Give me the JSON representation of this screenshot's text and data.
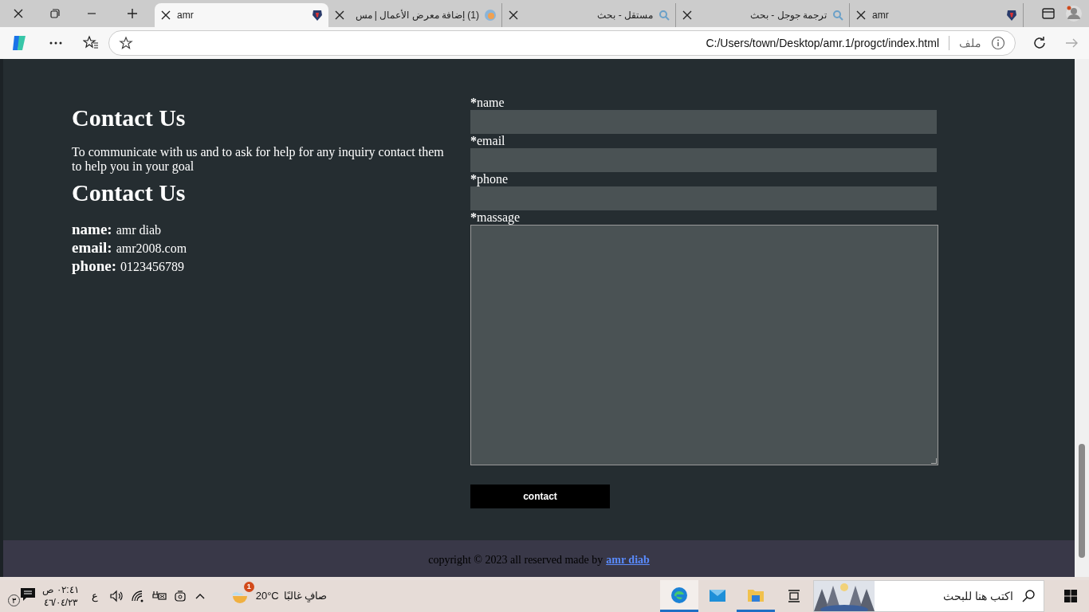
{
  "browser": {
    "tabs": [
      {
        "title": "amr",
        "selected": false,
        "kind": "shield"
      },
      {
        "title": "ترجمة جوجل - بحث",
        "selected": false,
        "kind": "search"
      },
      {
        "title": "مستقل - بحث",
        "selected": false,
        "kind": "search"
      },
      {
        "title": "(1) إضافة معرض الأعمال | مس",
        "selected": false,
        "kind": "globe"
      },
      {
        "title": "amr",
        "selected": true,
        "kind": "shield"
      }
    ],
    "address_bar": {
      "scheme": "ملف",
      "url": "C:/Users/town/Desktop/amr.1/progct/index.html"
    }
  },
  "page": {
    "intro_heading": "Contact Us",
    "intro": "To communicate with us and to ask for help for any inquiry contact them to help you in your goal",
    "details_heading": "Contact Us",
    "details": [
      {
        "label": "name:",
        "value": "amr diab"
      },
      {
        "label": "email:",
        "value": "amr2008.com"
      },
      {
        "label": "phone:",
        "value": "0123456789"
      }
    ],
    "form": {
      "fields": [
        {
          "mark": "*",
          "label": "name",
          "kind": "input"
        },
        {
          "mark": "*",
          "label": "email",
          "kind": "input"
        },
        {
          "mark": "*",
          "label": "phone",
          "kind": "input"
        },
        {
          "mark": "*",
          "label": "massage",
          "kind": "textarea"
        }
      ],
      "button": "contact"
    },
    "footer": {
      "text": "copyright © 2023 all reserved made by",
      "link": "amr diab"
    }
  },
  "taskbar": {
    "search_placeholder": "اكتب هنا للبحث",
    "apps": [
      {
        "kind": "edge",
        "running": true,
        "selected": true
      },
      {
        "kind": "mail",
        "running": false,
        "selected": false
      },
      {
        "kind": "explorer",
        "running": true,
        "selected": false
      }
    ],
    "weather": {
      "temperature": "20°C",
      "condition": "صافٍ غالبًا",
      "badge": "1"
    },
    "keyboard": "ع",
    "time": "٠٢:٤١ ص",
    "date": "٤٦/٠٤/٢٣",
    "notifications": "٣"
  }
}
